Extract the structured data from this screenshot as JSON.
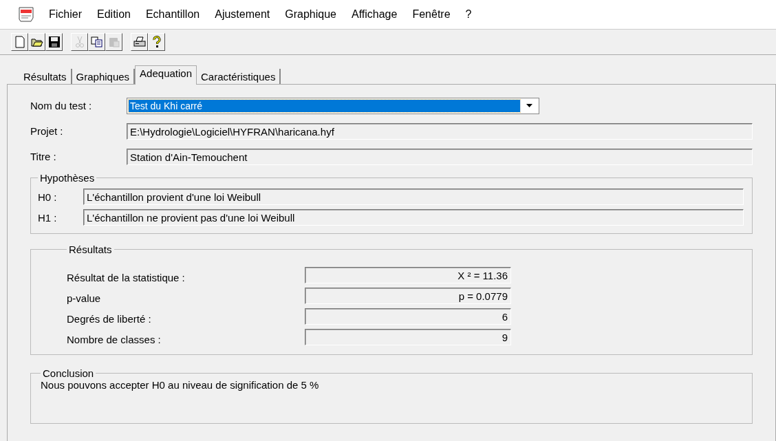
{
  "menu": [
    "Fichier",
    "Edition",
    "Echantillon",
    "Ajustement",
    "Graphique",
    "Affichage",
    "Fenêtre",
    "?"
  ],
  "toolbar": [
    [
      {
        "kind": "new",
        "disabled": false
      },
      {
        "kind": "open",
        "disabled": false
      },
      {
        "kind": "save",
        "disabled": false
      }
    ],
    [
      {
        "kind": "cut",
        "disabled": true
      },
      {
        "kind": "copy",
        "disabled": false
      },
      {
        "kind": "paste",
        "disabled": true
      }
    ],
    [
      {
        "kind": "print",
        "disabled": false
      },
      {
        "kind": "help",
        "disabled": false
      }
    ]
  ],
  "tabs": [
    {
      "label": "Résultats",
      "selected": false
    },
    {
      "label": "Graphiques",
      "selected": false
    },
    {
      "label": "Adequation",
      "selected": true
    },
    {
      "label": "Caractéristiques",
      "selected": false
    }
  ],
  "test": {
    "label": "Nom du test :",
    "value": "Test du Khi carré"
  },
  "fields": [
    {
      "label": "Projet :",
      "value": "E:\\Hydrologie\\Logiciel\\HYFRAN\\haricana.hyf"
    },
    {
      "label": "Titre :",
      "value": "Station d'Ain-Temouchent"
    }
  ],
  "hypotheses": {
    "title": "Hypothèses",
    "items": [
      {
        "label": "H0 :",
        "value": "L'échantillon provient d'une loi Weibull"
      },
      {
        "label": "H1 :",
        "value": "L'échantillon ne provient pas d'une loi Weibull"
      }
    ]
  },
  "results": {
    "title": "Résultats",
    "items": [
      {
        "label": "Résultat de la statistique :",
        "value": "X ² = 11.36"
      },
      {
        "label": "p-value",
        "value": "p = 0.0779"
      },
      {
        "label": "Degrés de liberté :",
        "value": "6"
      },
      {
        "label": "Nombre de classes :",
        "value": "9"
      }
    ]
  },
  "conclusion": {
    "title": "Conclusion",
    "text": "Nous pouvons accepter H0 au niveau de signification de 5 %"
  }
}
